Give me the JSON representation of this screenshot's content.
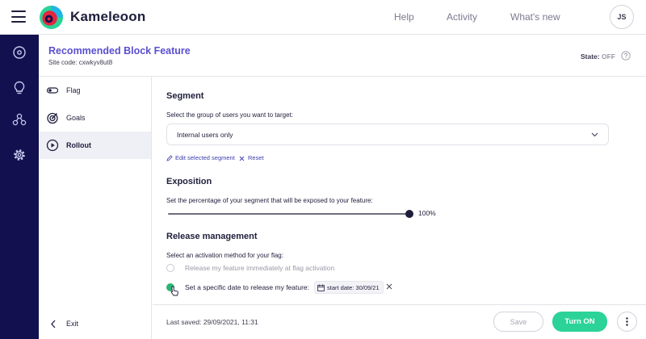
{
  "topbar": {
    "brand": "Kameleoon",
    "nav": [
      {
        "label": "Help"
      },
      {
        "label": "Activity"
      },
      {
        "label": "What's new"
      }
    ],
    "avatar_initials": "JS"
  },
  "rail": {
    "icons": [
      "dashboard-icon",
      "lightbulb-icon",
      "integrations-icon",
      "settings-gear-icon"
    ]
  },
  "header": {
    "title": "Recommended Block Feature",
    "site_code": "Site code: cxwkyv8ut8",
    "state_label": "State:",
    "state_value": "OFF"
  },
  "sidemenu": {
    "items": [
      {
        "label": "Flag",
        "icon": "toggle-icon"
      },
      {
        "label": "Goals",
        "icon": "target-icon"
      },
      {
        "label": "Rollout",
        "icon": "play-circle-icon",
        "active": true
      }
    ],
    "exit_label": "Exit"
  },
  "segment": {
    "title": "Segment",
    "subtitle": "Select the group of users you want to target:",
    "selected": "Internal users only",
    "edit_link": "Edit selected segment",
    "reset_link": "Reset"
  },
  "exposition": {
    "title": "Exposition",
    "subtitle": "Set the percentage of your segment that will be exposed to your feature:",
    "value_percent": 100,
    "value_label": "100%"
  },
  "release": {
    "title": "Release management",
    "subtitle": "Select an activation method for your flag:",
    "option_immediate": "Release my feature immediately at flag activation",
    "option_date": "Set a specific date to release my feature:",
    "date_chip": "start date: 30/09/21",
    "selected_option": "date"
  },
  "footer": {
    "last_saved": "Last saved: 29/09/2021, 11:31",
    "save_label": "Save",
    "turn_on_label": "Turn ON"
  },
  "colors": {
    "accent_purple": "#5a4fcf",
    "rail_navy": "#12104e",
    "success_green": "#2bd398"
  }
}
